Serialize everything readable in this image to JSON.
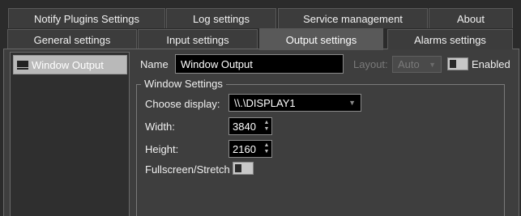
{
  "tabs_row1": [
    {
      "label": "Notify Plugins Settings"
    },
    {
      "label": "Log settings"
    },
    {
      "label": "Service management"
    },
    {
      "label": "About"
    }
  ],
  "tabs_row2": [
    {
      "label": "General settings"
    },
    {
      "label": "Input settings"
    },
    {
      "label": "Output settings",
      "active": true
    },
    {
      "label": "Alarms settings"
    }
  ],
  "outputs": [
    {
      "label": "Window Output",
      "icon": "monitor-icon",
      "selected": true
    }
  ],
  "form": {
    "name_label": "Name",
    "name_value": "Window Output",
    "layout_label": "Layout:",
    "layout_value": "Auto",
    "enabled_label": "Enabled",
    "enabled_on": false
  },
  "window_settings": {
    "title": "Window Settings",
    "choose_display_label": "Choose display:",
    "display_value": "\\\\.\\DISPLAY1",
    "width_label": "Width:",
    "width_value": "3840",
    "height_label": "Height:",
    "height_value": "2160",
    "fullscreen_label": "Fullscreen/Stretch",
    "fullscreen_on": false
  },
  "colors": {
    "background": "#2b2b2b",
    "panel": "#3e3e3e",
    "active_tab": "#595959",
    "selected_item": "#b9b9b9"
  }
}
